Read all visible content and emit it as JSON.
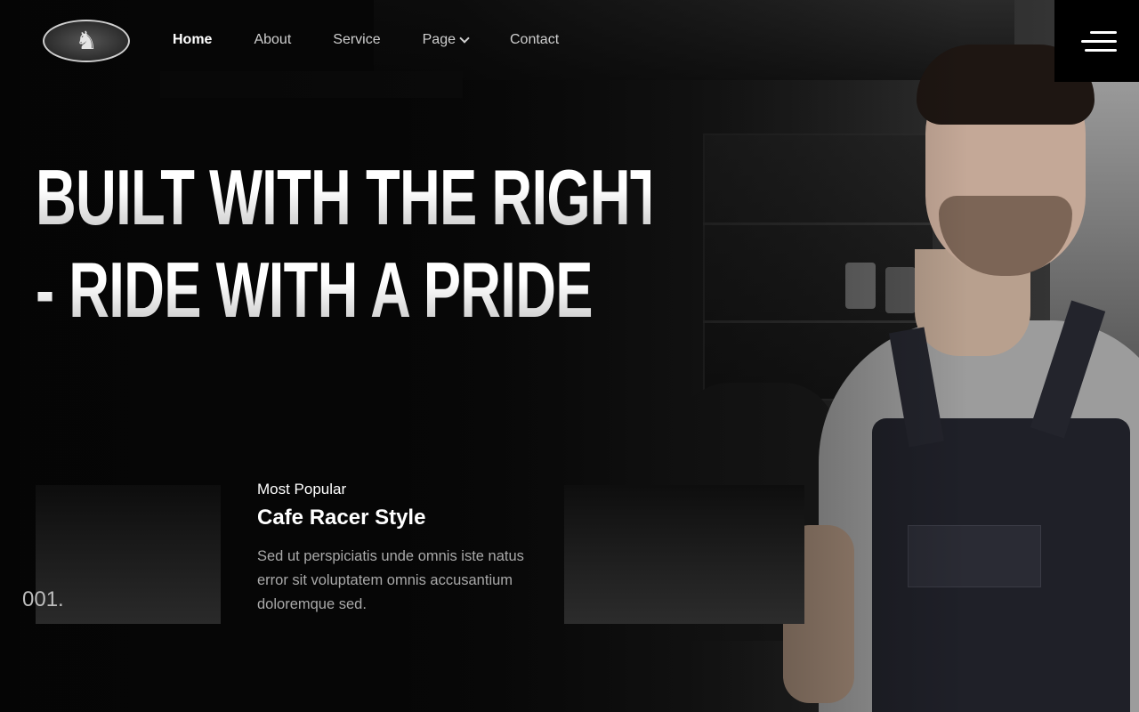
{
  "nav": {
    "logo_icon": "horse-logo",
    "links": [
      {
        "label": "Home",
        "active": true
      },
      {
        "label": "About"
      },
      {
        "label": "Service"
      },
      {
        "label": "Page",
        "has_dropdown": true
      },
      {
        "label": "Contact"
      }
    ],
    "menu_icon": "hamburger-icon"
  },
  "hero": {
    "headline_line1": "BUILT WITH THE RIGHT",
    "headline_line2": "- RIDE WITH A PRIDE",
    "slide_number": "001."
  },
  "card": {
    "kicker": "Most Popular",
    "title": "Cafe Racer Style",
    "description": "Sed ut perspiciatis unde omnis iste natus error sit voluptatem omnis accusantium doloremque sed."
  },
  "colors": {
    "background": "#0b0b0b",
    "text": "#ffffff",
    "muted": "#a9a9a9"
  }
}
